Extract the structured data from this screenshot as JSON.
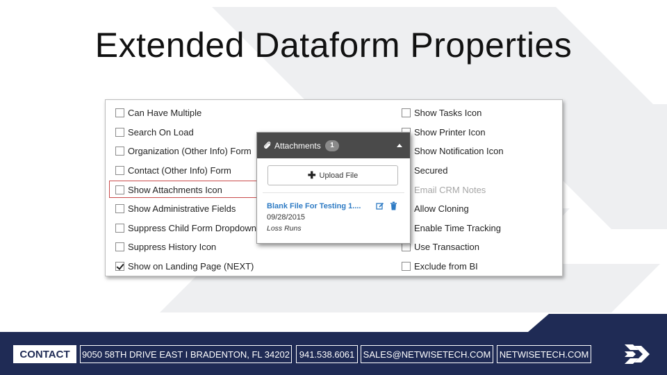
{
  "slide": {
    "title": "Extended Dataform Properties"
  },
  "options": {
    "left": [
      {
        "label": "Can Have Multiple",
        "checked": false
      },
      {
        "label": "Search On Load",
        "checked": false
      },
      {
        "label": "Organization (Other Info) Form",
        "checked": false
      },
      {
        "label": "Contact (Other Info) Form",
        "checked": false
      },
      {
        "label": "Show Attachments Icon",
        "checked": false,
        "highlighted": true
      },
      {
        "label": "Show Administrative Fields",
        "checked": false
      },
      {
        "label": "Suppress Child Form Dropdown",
        "checked": false
      },
      {
        "label": "Suppress History Icon",
        "checked": false
      },
      {
        "label": "Show on Landing Page (NEXT)",
        "checked": true
      }
    ],
    "right": [
      {
        "label": "Show Tasks Icon",
        "checked": false
      },
      {
        "label": "Show Printer Icon",
        "checked": false
      },
      {
        "label": "Show Notification Icon",
        "checked": false
      },
      {
        "label": "Secured",
        "checked": false
      },
      {
        "label": "Email CRM Notes",
        "checked": false,
        "disabled": true
      },
      {
        "label": "Allow Cloning",
        "checked": false
      },
      {
        "label": "Enable Time Tracking",
        "checked": false
      },
      {
        "label": "Use Transaction",
        "checked": false
      },
      {
        "label": "Exclude from BI",
        "checked": false
      }
    ]
  },
  "attachments": {
    "title": "Attachments",
    "count": "1",
    "upload_label": "Upload File",
    "file": {
      "name": "Blank File For Testing 1....",
      "date": "09/28/2015",
      "category": "Loss Runs"
    }
  },
  "footer": {
    "contact": "CONTACT",
    "address": "9050 58TH DRIVE EAST I BRADENTON, FL 34202",
    "phone": "941.538.6061",
    "email": "SALES@NETWISETECH.COM",
    "website": "NETWISETECH.COM"
  },
  "colors": {
    "accent": "#2e7bc4",
    "footer_bg": "#1f2b55",
    "header_bar": "#4a4a4a",
    "highlight_border": "#c94b4b"
  }
}
